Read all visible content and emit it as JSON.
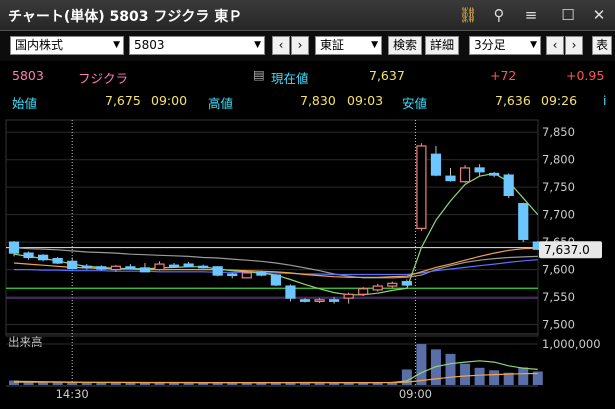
{
  "window": {
    "title": "チャート(単体) 5803 フジクラ 東Ｐ",
    "icons": [
      "link-icon",
      "search-icon",
      "menu-icon",
      "maximize-icon",
      "close-icon"
    ]
  },
  "toolbar": {
    "market_select": "国内株式",
    "code_input": "5803",
    "prev": "‹",
    "next": "›",
    "exchange_select": "東証",
    "search_button": "検索",
    "detail_button": "詳細",
    "interval_select": "3分足",
    "interval_prev": "‹",
    "interval_next": "›",
    "extra_button": "表"
  },
  "quote": {
    "code": "5803",
    "name": "フジクラ",
    "current_label": "現在値",
    "current_value": "7,637",
    "change": "+72",
    "change_pct": "+0.95",
    "open_label": "始値",
    "open_value": "7,675",
    "open_time": "09:00",
    "high_label": "高値",
    "high_value": "7,830",
    "high_time": "09:03",
    "low_label": "安値",
    "low_value": "7,636",
    "low_time": "09:26",
    "extra_marker": "i"
  },
  "colors": {
    "up": "#f08080",
    "down": "#6ec6ff",
    "text_yellow": "#f5e36a",
    "text_cyan": "#3fe0ff",
    "text_red": "#ff5555",
    "text_pink": "#ff7eb6",
    "volume": "#5a6fa8",
    "ma_fast": "#8fd47a",
    "ma_mid": "#f2a44b",
    "ma_slow": "#5a6fff",
    "hline_green": "#3cd53c",
    "price_tag": "#f2e41f"
  },
  "chart_data": {
    "type": "candlestick",
    "y_ticks": [
      "7,850",
      "7,800",
      "7,750",
      "7,700",
      "7,650",
      "7,600",
      "7,550",
      "7,500"
    ],
    "ylim": [
      7490,
      7865
    ],
    "volume_label": "出来高",
    "volume_tick": "1,000,000",
    "x_labels": [
      "14:30",
      "09:00"
    ],
    "x_label_index": [
      4,
      28
    ],
    "last_price_label": "7,637.0",
    "last_price": 7637,
    "hline_green": 7566,
    "hline_white": 7640,
    "candles": [
      {
        "o": 7650,
        "h": 7652,
        "l": 7624,
        "c": 7630
      },
      {
        "o": 7630,
        "h": 7633,
        "l": 7618,
        "c": 7622
      },
      {
        "o": 7626,
        "h": 7628,
        "l": 7615,
        "c": 7618
      },
      {
        "o": 7620,
        "h": 7623,
        "l": 7610,
        "c": 7612
      },
      {
        "o": 7615,
        "h": 7622,
        "l": 7600,
        "c": 7602
      },
      {
        "o": 7606,
        "h": 7610,
        "l": 7600,
        "c": 7604
      },
      {
        "o": 7605,
        "h": 7608,
        "l": 7598,
        "c": 7601
      },
      {
        "o": 7600,
        "h": 7608,
        "l": 7596,
        "c": 7606
      },
      {
        "o": 7605,
        "h": 7610,
        "l": 7600,
        "c": 7603
      },
      {
        "o": 7603,
        "h": 7612,
        "l": 7598,
        "c": 7596
      },
      {
        "o": 7600,
        "h": 7615,
        "l": 7598,
        "c": 7610
      },
      {
        "o": 7608,
        "h": 7612,
        "l": 7605,
        "c": 7606
      },
      {
        "o": 7610,
        "h": 7614,
        "l": 7604,
        "c": 7606
      },
      {
        "o": 7606,
        "h": 7609,
        "l": 7602,
        "c": 7605
      },
      {
        "o": 7605,
        "h": 7606,
        "l": 7588,
        "c": 7590
      },
      {
        "o": 7592,
        "h": 7594,
        "l": 7584,
        "c": 7590
      },
      {
        "o": 7585,
        "h": 7598,
        "l": 7584,
        "c": 7594
      },
      {
        "o": 7595,
        "h": 7598,
        "l": 7588,
        "c": 7590
      },
      {
        "o": 7590,
        "h": 7592,
        "l": 7570,
        "c": 7572
      },
      {
        "o": 7570,
        "h": 7573,
        "l": 7542,
        "c": 7548
      },
      {
        "o": 7545,
        "h": 7548,
        "l": 7540,
        "c": 7543
      },
      {
        "o": 7542,
        "h": 7548,
        "l": 7539,
        "c": 7545
      },
      {
        "o": 7545,
        "h": 7550,
        "l": 7538,
        "c": 7543
      },
      {
        "o": 7548,
        "h": 7558,
        "l": 7538,
        "c": 7555
      },
      {
        "o": 7555,
        "h": 7568,
        "l": 7552,
        "c": 7565
      },
      {
        "o": 7563,
        "h": 7574,
        "l": 7560,
        "c": 7570
      },
      {
        "o": 7570,
        "h": 7578,
        "l": 7567,
        "c": 7575
      },
      {
        "o": 7578,
        "h": 7582,
        "l": 7570,
        "c": 7572
      },
      {
        "o": 7675,
        "h": 7830,
        "l": 7670,
        "c": 7825
      },
      {
        "o": 7810,
        "h": 7825,
        "l": 7770,
        "c": 7772
      },
      {
        "o": 7770,
        "h": 7785,
        "l": 7760,
        "c": 7762
      },
      {
        "o": 7760,
        "h": 7790,
        "l": 7758,
        "c": 7785
      },
      {
        "o": 7785,
        "h": 7792,
        "l": 7770,
        "c": 7778
      },
      {
        "o": 7775,
        "h": 7778,
        "l": 7768,
        "c": 7772
      },
      {
        "o": 7772,
        "h": 7775,
        "l": 7730,
        "c": 7735
      },
      {
        "o": 7720,
        "h": 7722,
        "l": 7650,
        "c": 7655
      },
      {
        "o": 7650,
        "h": 7652,
        "l": 7636,
        "c": 7637
      }
    ],
    "volumes": [
      110000,
      80000,
      75000,
      70000,
      65000,
      60000,
      60000,
      55000,
      60000,
      55000,
      60000,
      50000,
      55000,
      50000,
      60000,
      55000,
      55000,
      50000,
      60000,
      70000,
      60000,
      55000,
      55000,
      60000,
      55000,
      60000,
      65000,
      380000,
      1000000,
      870000,
      760000,
      520000,
      420000,
      360000,
      300000,
      430000,
      330000
    ],
    "ma_fast": [
      7628,
      7624,
      7620,
      7616,
      7610,
      7606,
      7604,
      7602,
      7602,
      7601,
      7603,
      7604,
      7605,
      7605,
      7601,
      7598,
      7596,
      7594,
      7590,
      7582,
      7573,
      7565,
      7558,
      7554,
      7554,
      7557,
      7562,
      7566,
      7640,
      7690,
      7725,
      7755,
      7770,
      7775,
      7760,
      7730,
      7700
    ],
    "ma_mid": [
      7612,
      7610,
      7608,
      7606,
      7604,
      7603,
      7602,
      7601,
      7601,
      7600,
      7600,
      7600,
      7600,
      7600,
      7600,
      7599,
      7598,
      7597,
      7596,
      7594,
      7591,
      7589,
      7587,
      7586,
      7586,
      7586,
      7587,
      7588,
      7596,
      7604,
      7610,
      7617,
      7624,
      7630,
      7635,
      7638,
      7639
    ],
    "ma_slow": [
      7600,
      7600,
      7599,
      7599,
      7598,
      7598,
      7598,
      7597,
      7597,
      7597,
      7596,
      7596,
      7596,
      7596,
      7595,
      7595,
      7595,
      7594,
      7594,
      7593,
      7592,
      7592,
      7591,
      7591,
      7591,
      7591,
      7591,
      7591,
      7594,
      7598,
      7601,
      7604,
      7607,
      7610,
      7613,
      7616,
      7618
    ],
    "ma_long": [
      7640,
      7638,
      7637,
      7636,
      7634,
      7632,
      7631,
      7630,
      7628,
      7627,
      7626,
      7625,
      7624,
      7622,
      7621,
      7619,
      7617,
      7615,
      7612,
      7608,
      7603,
      7598,
      7592,
      7588,
      7585,
      7585,
      7585,
      7586,
      7590,
      7600,
      7607,
      7613,
      7617,
      7620,
      7622,
      7623,
      7624
    ],
    "vol_ma1": [
      90000,
      85000,
      80000,
      75000,
      70000,
      65000,
      62000,
      60000,
      58000,
      57000,
      57000,
      56000,
      55000,
      54000,
      55000,
      55000,
      55000,
      54000,
      55000,
      58000,
      60000,
      60000,
      58000,
      57000,
      57000,
      58000,
      60000,
      100000,
      300000,
      450000,
      520000,
      560000,
      590000,
      560000,
      470000,
      410000,
      380000
    ],
    "vol_ma2": [
      70000,
      70000,
      69000,
      68000,
      67000,
      66000,
      65000,
      64000,
      63000,
      62000,
      61000,
      60000,
      60000,
      59000,
      59000,
      58000,
      58000,
      58000,
      58000,
      59000,
      59000,
      59000,
      59000,
      59000,
      59000,
      59000,
      60000,
      70000,
      110000,
      150000,
      190000,
      220000,
      240000,
      255000,
      265000,
      275000,
      280000
    ]
  }
}
